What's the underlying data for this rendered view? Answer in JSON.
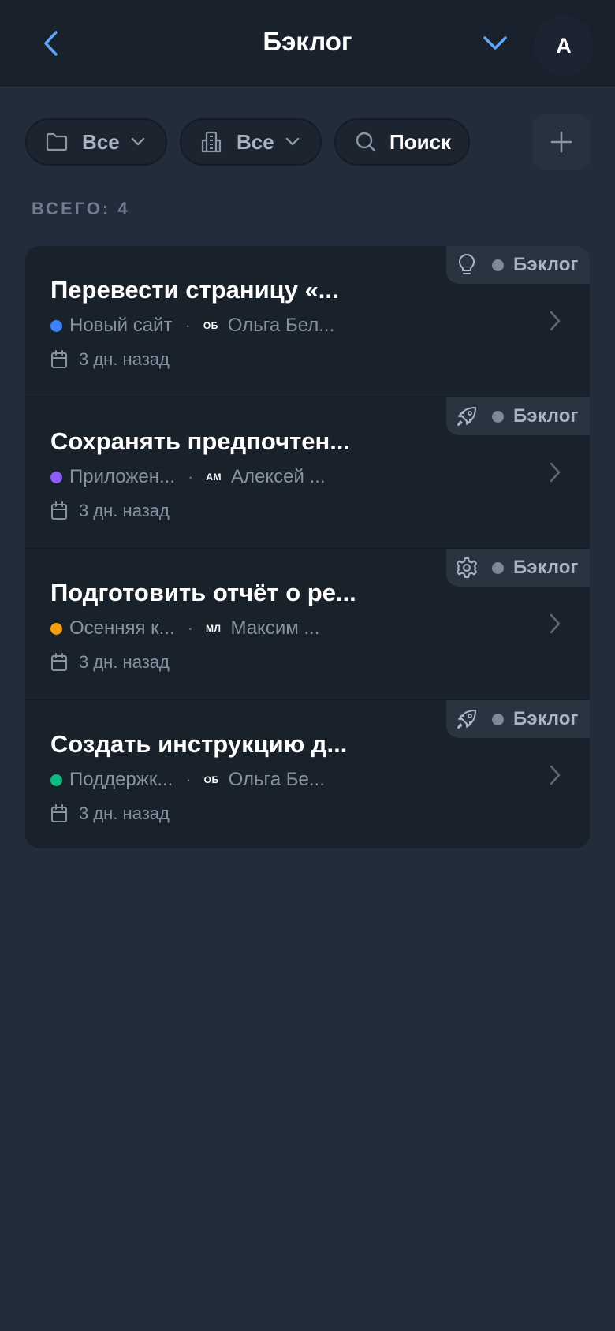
{
  "header": {
    "title": "Бэклог",
    "avatar_initial": "A",
    "icons": {
      "back": "chevron-left-icon",
      "menu": "chevron-down-icon"
    },
    "accent_color": "#60a5fa"
  },
  "filters": {
    "folder": {
      "label": "Все",
      "icon": "folder-icon"
    },
    "organization": {
      "label": "Все",
      "icon": "building-icon"
    },
    "search": {
      "label": "Поиск",
      "icon": "search-icon"
    },
    "add_icon": "plus-icon"
  },
  "total_label": "ВСЕГО: 4",
  "tasks": [
    {
      "title": "Перевести страницу «...",
      "badge_icon": "lightbulb-icon",
      "status": "Бэклог",
      "project": "Новый сайт",
      "project_color": "#3b82f6",
      "initials": "ОБ",
      "assignee": "Ольга Бел...",
      "date": "3 дн. назад"
    },
    {
      "title": "Сохранять предпочтен...",
      "badge_icon": "rocket-icon",
      "status": "Бэклог",
      "project": "Приложен...",
      "project_color": "#8b5cf6",
      "initials": "АМ",
      "assignee": "Алексей ...",
      "date": "3 дн. назад"
    },
    {
      "title": "Подготовить отчёт о ре...",
      "badge_icon": "gear-icon",
      "status": "Бэклог",
      "project": "Осенняя к...",
      "project_color": "#f59e0b",
      "initials": "МЛ",
      "assignee": "Максим ...",
      "date": "3 дн. назад"
    },
    {
      "title": "Создать инструкцию д...",
      "badge_icon": "rocket-icon",
      "status": "Бэклог",
      "project": "Поддержк...",
      "project_color": "#10b981",
      "initials": "ОБ",
      "assignee": "Ольга Бе...",
      "date": "3 дн. назад"
    }
  ]
}
